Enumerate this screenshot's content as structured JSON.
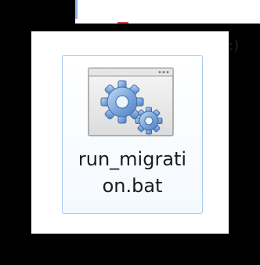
{
  "desktop": {
    "peek_text": ":)"
  },
  "file": {
    "icon_name": "gear-batch-file-icon",
    "label_line1": "run_migrati",
    "label_line2": "on.bat"
  },
  "colors": {
    "selection_border": "#a8c8ee",
    "frame": "#000000",
    "gear": "#6f9fd6"
  }
}
